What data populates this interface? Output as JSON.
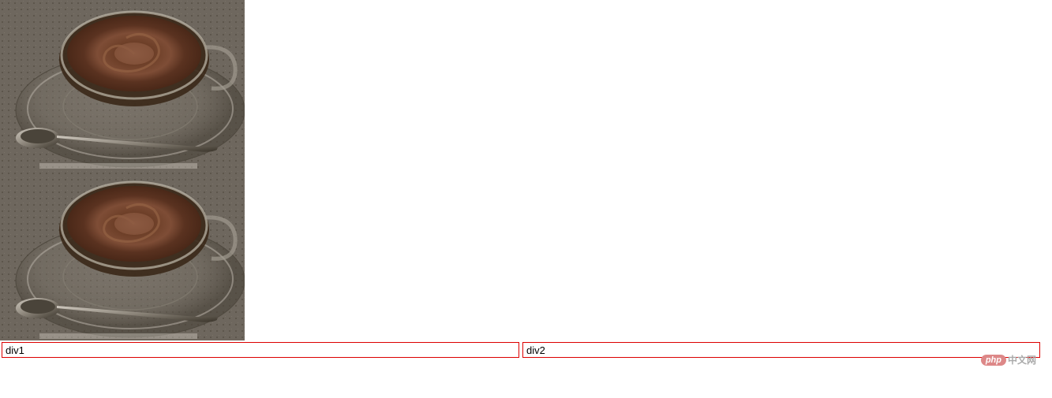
{
  "image1": {
    "alt": "coffee-cup-photo"
  },
  "image2": {
    "alt": "coffee-cup-photo"
  },
  "divs": {
    "div1_label": "div1",
    "div2_label": "div2"
  },
  "watermark": {
    "badge_text": "php",
    "text": "中文网"
  }
}
